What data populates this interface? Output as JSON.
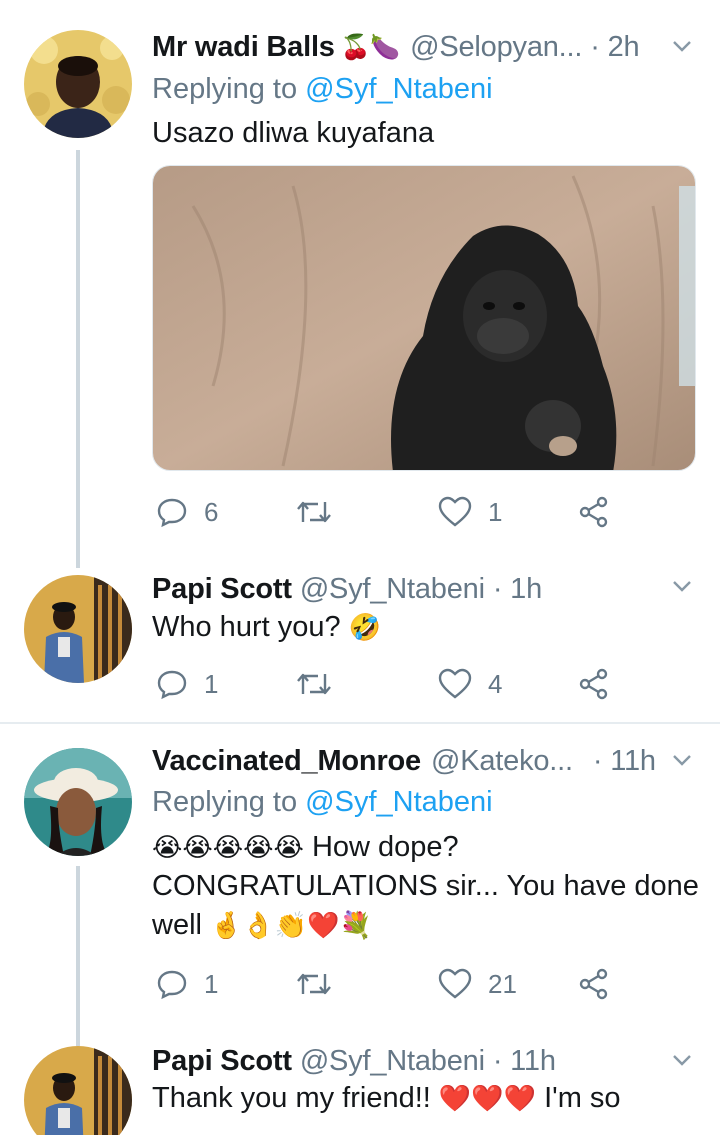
{
  "tweets": [
    {
      "name": "Mr wadi Balls",
      "name_emoji": "🍒🍆",
      "handle": "@Selopyan...",
      "time": "· 2h",
      "replying_label": "Replying to",
      "replying_to": "@Syf_Ntabeni",
      "text": "Usazo dliwa kuyafana",
      "reply_count": "6",
      "retweet_count": "",
      "like_count": "1"
    },
    {
      "name": "Papi Scott",
      "handle": "@Syf_Ntabeni",
      "time": "· 1h",
      "text": "Who hurt you?",
      "text_emoji": "🤣",
      "reply_count": "1",
      "retweet_count": "",
      "like_count": "4"
    },
    {
      "name": "Vaccinated_Monroe",
      "handle": "@Kateko...",
      "time": "· 11h",
      "replying_label": "Replying to",
      "replying_to": "@Syf_Ntabeni",
      "text_line1_emoji": "😭😭😭😭😭",
      "text_line1": "How dope?",
      "text_line2": "CONGRATULATIONS sir... You have done",
      "text_line3": "well",
      "text_line3_emoji": "🤞👌👏❤️💐",
      "reply_count": "1",
      "retweet_count": "",
      "like_count": "21"
    },
    {
      "name": "Papi Scott",
      "handle": "@Syf_Ntabeni",
      "time": "· 11h",
      "text_part1": "Thank you my friend!!",
      "text_emoji": "❤️❤️❤️",
      "text_part2": "I'm so"
    }
  ],
  "colors": {
    "text": "#14171a",
    "secondary": "#657786",
    "link": "#1da1f2",
    "thread_line": "#ccd6dd",
    "divider": "#e6ecf0"
  }
}
